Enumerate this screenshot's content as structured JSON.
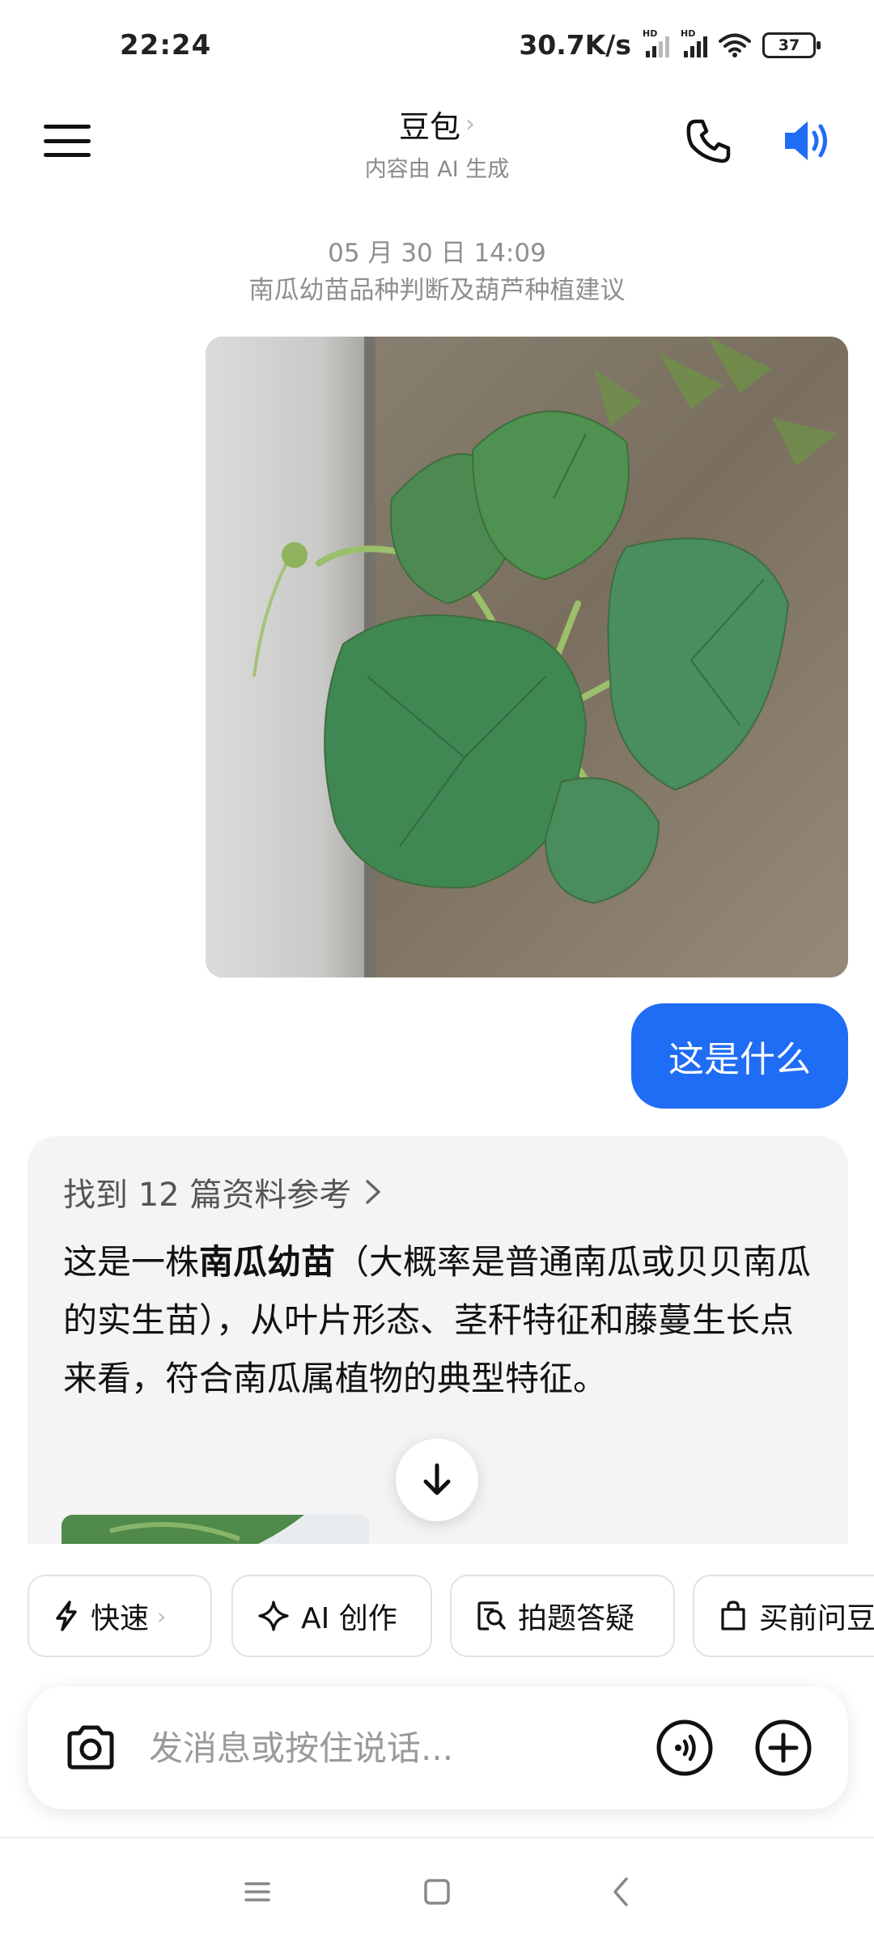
{
  "status_bar": {
    "time": "22:24",
    "network_speed": "30.7K/s",
    "hd_label": "HD",
    "battery": "37"
  },
  "header": {
    "title": "豆包",
    "title_chevron": "›",
    "subtitle": "内容由 AI 生成",
    "icons": [
      "menu-icon",
      "phone-icon",
      "speaker-icon"
    ],
    "accent_color": "#1f6cf5"
  },
  "conversation": {
    "date": "05 月 30 日 14:09",
    "topic": "南瓜幼苗品种判断及葫芦种植建议",
    "user_message": "这是什么",
    "references_label": "找到 12 篇资料参考",
    "answer": {
      "prefix": "这是一株",
      "bold": "南瓜幼苗",
      "rest": "（大概率是普通南瓜或贝贝南瓜的实生苗），从叶片形态、茎秆特征和藤蔓生长点来看，符合南瓜属植物的典型特征。"
    }
  },
  "quick_actions": [
    {
      "label": "快速",
      "icon": "lightning-icon"
    },
    {
      "label": "AI 创作",
      "icon": "sparkle-icon"
    },
    {
      "label": "拍题答疑",
      "icon": "question-search-icon"
    },
    {
      "label": "买前问豆",
      "icon": "shopping-bag-icon"
    }
  ],
  "input": {
    "placeholder": "发消息或按住说话..."
  }
}
